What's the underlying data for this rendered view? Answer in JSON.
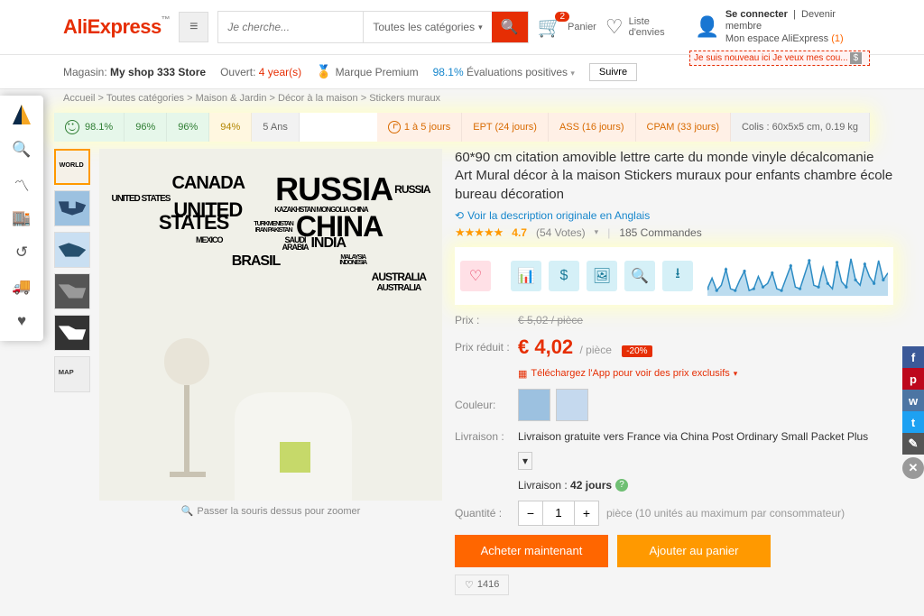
{
  "header": {
    "logo": "AliExpress",
    "search_placeholder": "Je cherche...",
    "categories": "Toutes les catégories",
    "cart_count": "2",
    "cart_label": "Panier",
    "wishlist": "Liste d'envies",
    "signin": "Se connecter",
    "register": "Devenir membre",
    "space": "Mon espace AliExpress",
    "space_count": "(1)",
    "promo": "Je suis nouveau ici Je veux mes cou...",
    "promo_sym": "$"
  },
  "subheader": {
    "magasin_label": "Magasin:",
    "shop_name": "My shop 333 Store",
    "open_label": "Ouvert:",
    "open_years": "4 year(s)",
    "premium": "Marque Premium",
    "pos_pct": "98.1%",
    "pos_label": "Évaluations positives",
    "follow": "Suivre"
  },
  "breadcrumb": {
    "items": [
      "Accueil",
      "Toutes catégories",
      "Maison & Jardin",
      "Décor à la maison",
      "Stickers muraux"
    ]
  },
  "stats": {
    "smiley": "98.1%",
    "g2": "96%",
    "g3": "96%",
    "yellow": "94%",
    "years": "5 Ans",
    "ship_range": "1 à 5 jours",
    "ept": "EPT (24 jours)",
    "ass": "ASS (16 jours)",
    "cpam": "CPAM (33 jours)",
    "colis": "Colis : 60x5x5 cm, 0.19 kg"
  },
  "product": {
    "title": "60*90 cm citation amovible lettre carte du monde vinyle décalcomanie Art Mural décor à la maison Stickers muraux pour enfants chambre école bureau décoration",
    "orig_link": "Voir la description originale en Anglais",
    "rating_val": "4.7",
    "votes": "(54 Votes)",
    "orders": "185 Commandes",
    "zoom_hint": "Passer la souris dessus pour zoomer",
    "price_label": "Prix :",
    "old_price": "€ 5,02 / pièce",
    "reduced_label": "Prix réduit :",
    "new_price": "€ 4,02",
    "price_unit": "/ pièce",
    "discount": "-20%",
    "app_promo": "Téléchargez l'App pour voir des prix exclusifs",
    "color_label": "Couleur:",
    "ship_label": "Livraison :",
    "ship_text": "Livraison gratuite vers France via China Post Ordinary Small Packet Plus",
    "ship_time_label": "Livraison :",
    "ship_time": "42 jours",
    "qty_label": "Quantité :",
    "qty_val": "1",
    "qty_note": "pièce (10 unités au maximum par consommateur)",
    "buy": "Acheter maintenant",
    "cart": "Ajouter au panier",
    "likes": "1416"
  },
  "chart_data": {
    "type": "line",
    "title": "",
    "xlabel": "",
    "ylabel": "",
    "x": [
      0,
      1,
      2,
      3,
      4,
      5,
      6,
      7,
      8,
      9,
      10,
      11,
      12,
      13,
      14,
      15,
      16,
      17,
      18,
      19,
      20,
      21,
      22,
      23,
      24,
      25,
      26,
      27,
      28,
      29,
      30,
      31,
      32,
      33,
      34,
      35,
      36,
      37,
      38,
      39
    ],
    "series": [
      {
        "name": "sales",
        "values": [
          8,
          20,
          6,
          12,
          30,
          8,
          6,
          18,
          28,
          6,
          8,
          22,
          10,
          14,
          26,
          8,
          6,
          20,
          34,
          10,
          8,
          24,
          40,
          12,
          10,
          32,
          14,
          8,
          38,
          16,
          10,
          42,
          18,
          12,
          36,
          22,
          14,
          40,
          18,
          26
        ]
      }
    ],
    "ylim": [
      0,
      45
    ]
  }
}
